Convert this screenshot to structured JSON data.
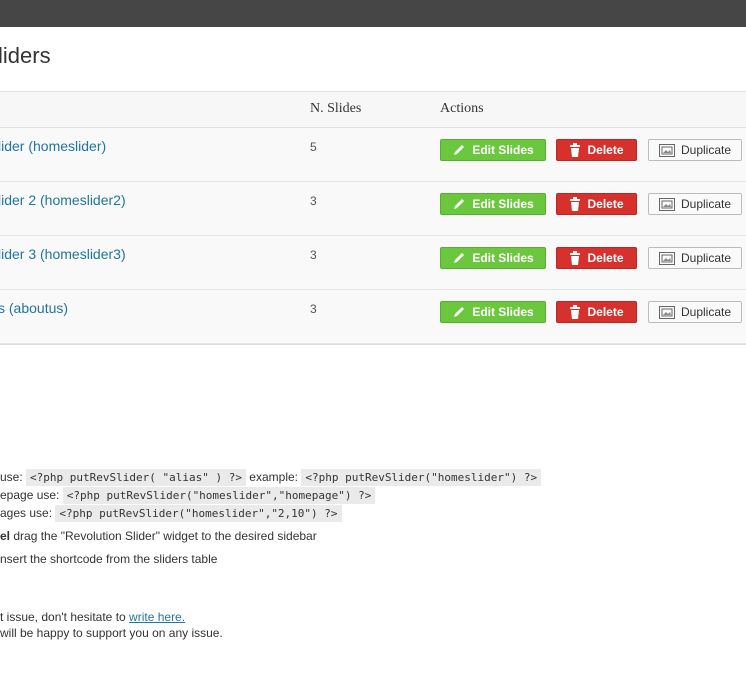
{
  "page": {
    "title": "liders"
  },
  "table": {
    "col_slides": "N. Slides",
    "col_actions": "Actions",
    "rows": [
      {
        "name": "lider (homeslider)",
        "count": "5"
      },
      {
        "name": "lider 2 (homeslider2)",
        "count": "3"
      },
      {
        "name": "lider 3 (homeslider3)",
        "count": "3"
      },
      {
        "name": "s (aboutus)",
        "count": "3"
      }
    ],
    "edit_label": "Edit Slides",
    "delete_label": "Delete",
    "duplicate_label": "Duplicate"
  },
  "help": {
    "line1_prefix": "use:",
    "line1_code1": "<?php putRevSlider( \"alias\" ) ?>",
    "line1_mid": "example:",
    "line1_code2": "<?php putRevSlider(\"homeslider\") ?>",
    "line2_prefix": "epage use:",
    "line2_code": "<?php putRevSlider(\"homeslider\",\"homepage\") ?>",
    "line3_prefix": "ages use:",
    "line3_code": "<?php putRevSlider(\"homeslider\",\"2,10\") ?>",
    "line4_bold": "el",
    "line4_text": "drag the \"Revolution Slider\" widget to the desired sidebar",
    "line5_text": "nsert the shortcode from the sliders table",
    "line6_text": "t issue, don't hesitate to",
    "line6_link": "write here.",
    "line7_text": "will be happy to support you on any issue."
  }
}
